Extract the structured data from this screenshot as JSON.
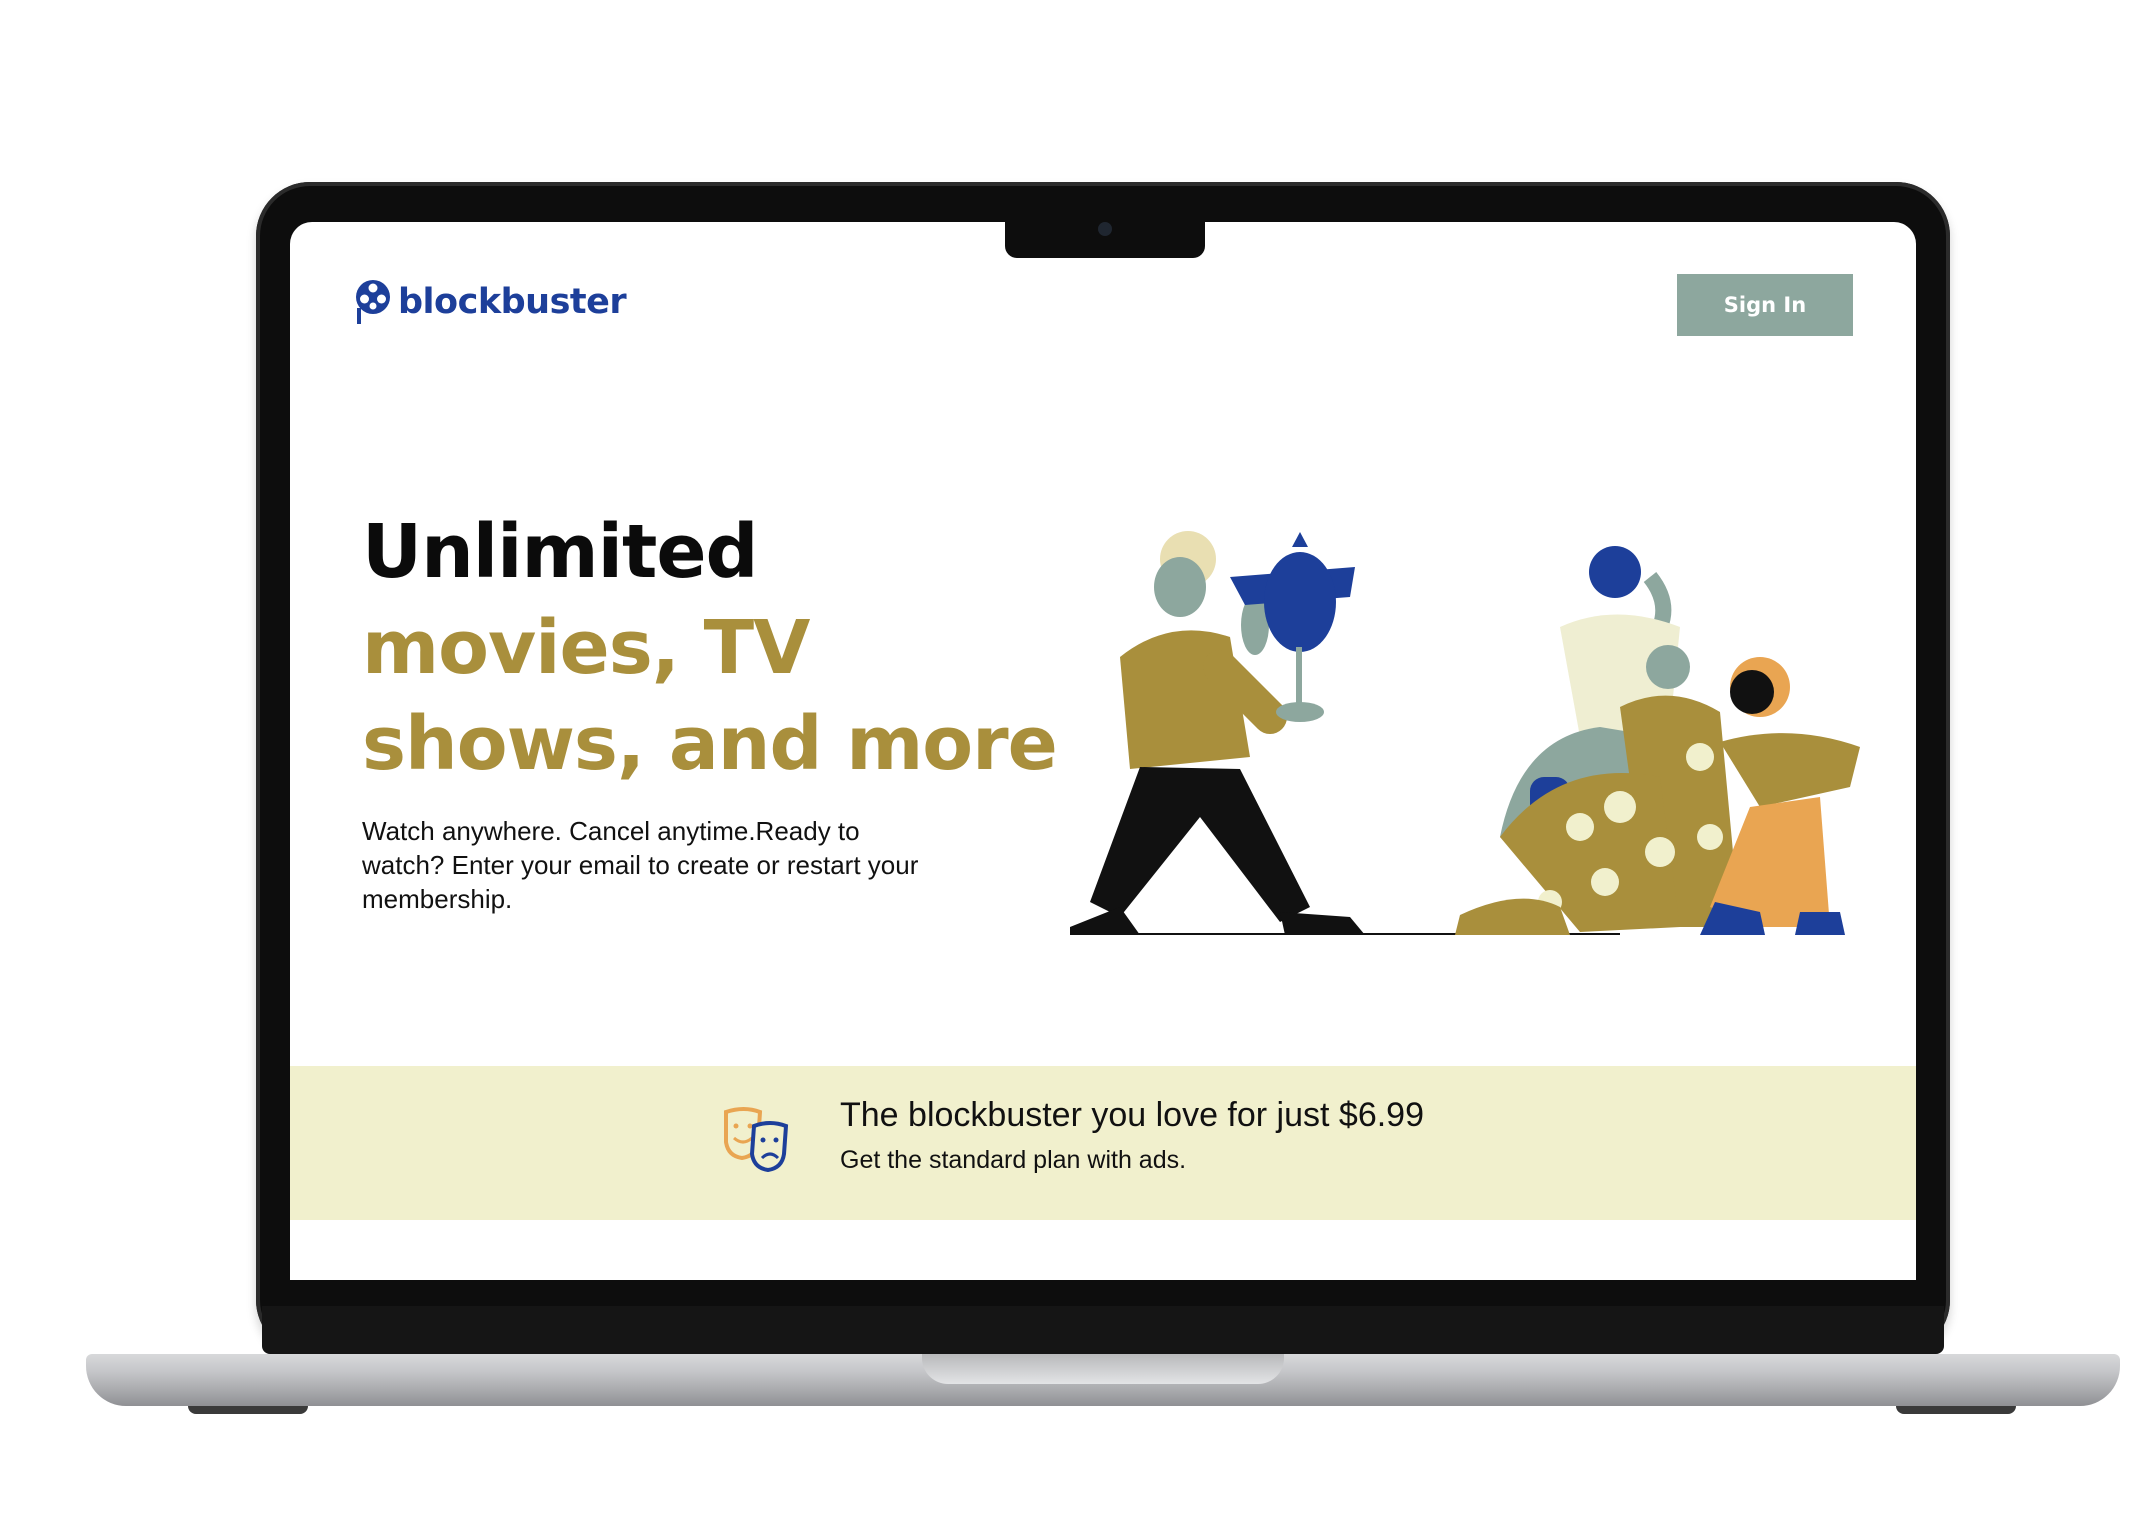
{
  "header": {
    "brand": "blockbuster",
    "sign_in_label": "Sign In",
    "logo_icon": "film-reel-icon"
  },
  "hero": {
    "line1": "Unlimited",
    "line2": "movies, TV",
    "line3": "shows, and more",
    "description": "Watch anywhere. Cancel anytime.Ready to watch? Enter your email to create or restart your membership.",
    "illustration": "people-watching-illustration"
  },
  "promo": {
    "title": "The blockbuster you love for just $6.99",
    "subtitle": "Get the standard plan with ads.",
    "icon": "theater-masks-icon"
  },
  "colors": {
    "brand_blue": "#1d3f9a",
    "accent_gold": "#a98f3c",
    "button_green": "#8da79e",
    "promo_bg": "#f1f0cd"
  }
}
